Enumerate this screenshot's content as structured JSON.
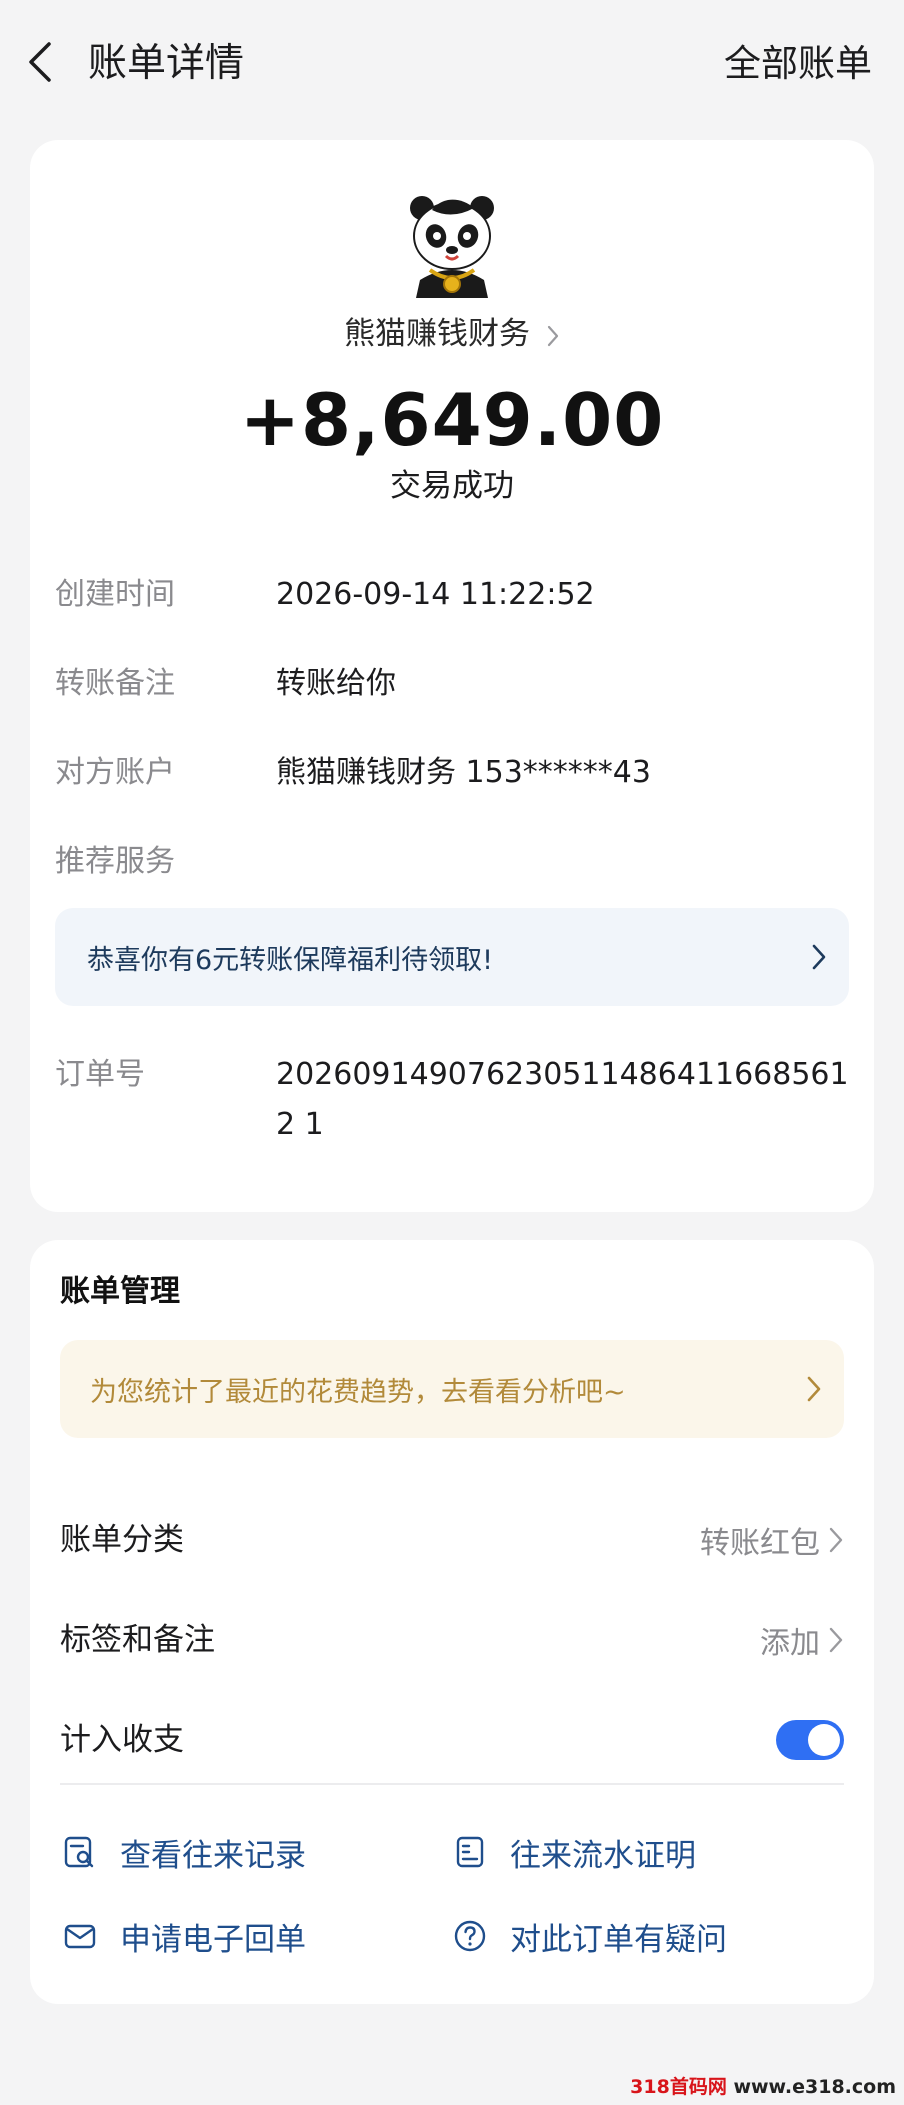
{
  "header": {
    "title": "账单详情",
    "all_bills": "全部账单"
  },
  "summary": {
    "merchant": "熊猫赚钱财务",
    "amount": "+8,649.00",
    "status": "交易成功"
  },
  "details": {
    "created_label": "创建时间",
    "created_value": "2026-09-14 11:22:52",
    "note_label": "转账备注",
    "note_value": "转账给你",
    "counterparty_label": "对方账户",
    "counterparty_value": "熊猫赚钱财务 153******43",
    "recommend_label": "推荐服务",
    "promo_text": "恭喜你有6元转账保障福利待领取!",
    "order_label": "订单号",
    "order_value": "2026091490762305114864116685612 1"
  },
  "management": {
    "title": "账单管理",
    "trend_text": "为您统计了最近的花费趋势，去看看分析吧~",
    "category_label": "账单分类",
    "category_value": "转账红包",
    "tags_label": "标签和备注",
    "tags_value": "添加",
    "count_label": "计入收支",
    "count_enabled": true,
    "actions": {
      "records": "查看往来记录",
      "statement": "往来流水证明",
      "receipt": "申请电子回单",
      "question": "对此订单有疑问"
    }
  },
  "watermark": {
    "brand": "318首码网",
    "url": "www.e318.com"
  },
  "colors": {
    "accent": "#2f6ff3",
    "link": "#1f4e8c",
    "gold_text": "#b28a3a"
  }
}
